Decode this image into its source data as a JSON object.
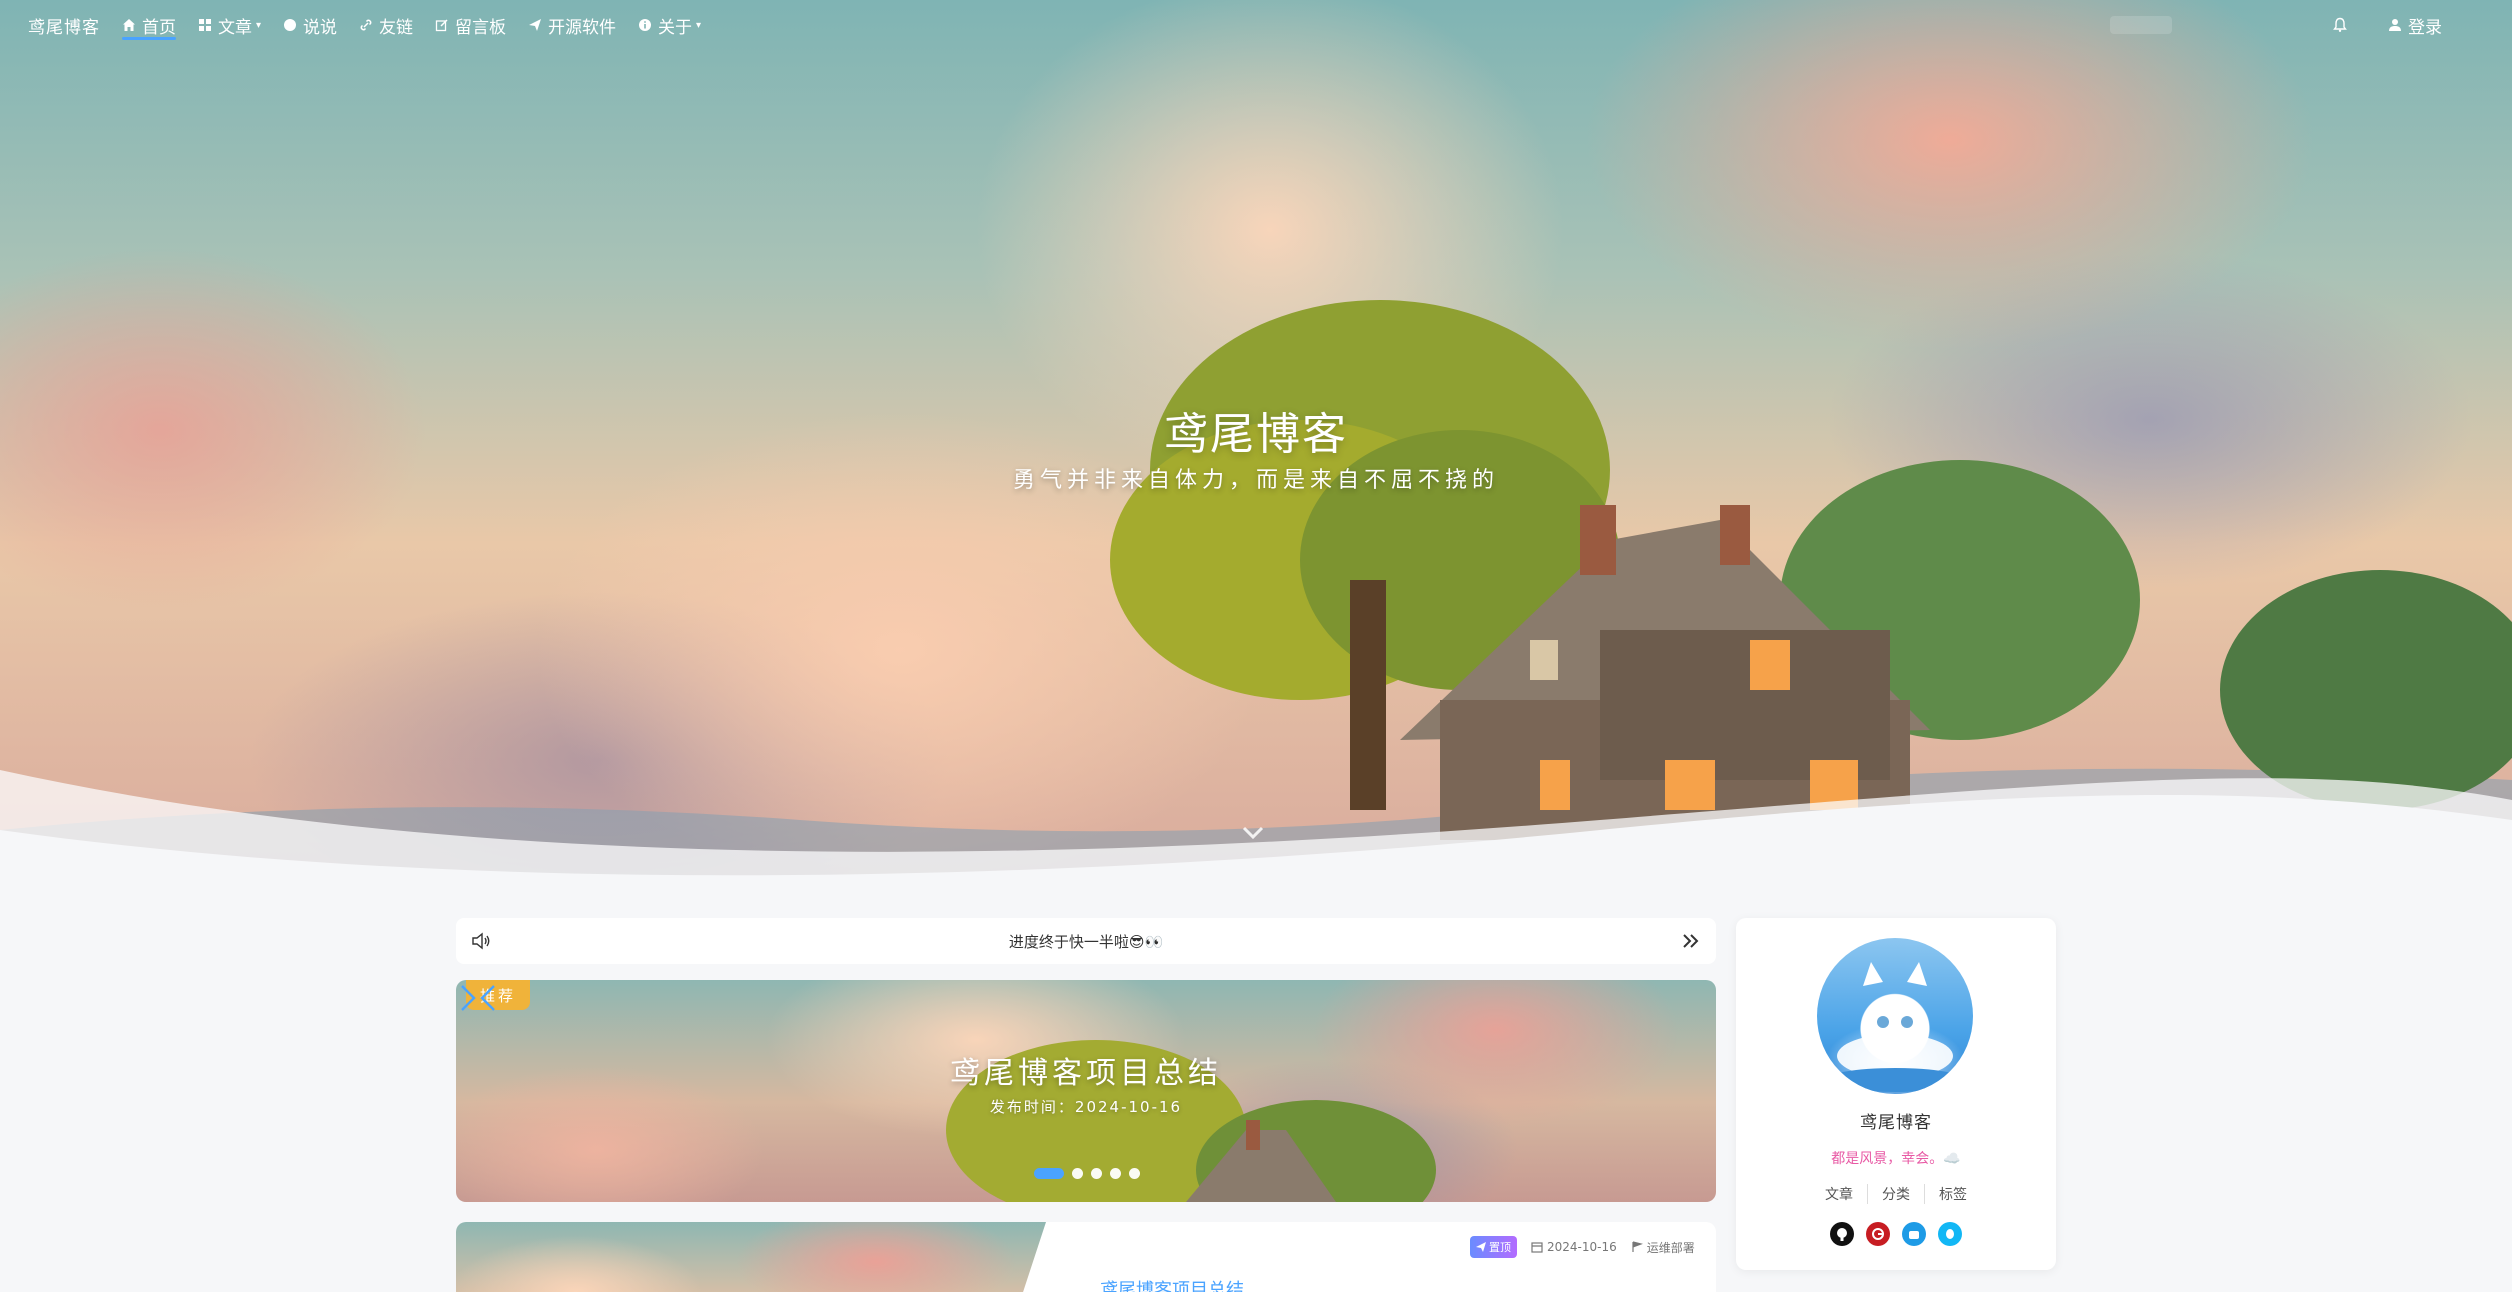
{
  "nav": {
    "brand": "鸢尾博客",
    "items": [
      {
        "label": "首页",
        "icon": "home-icon"
      },
      {
        "label": "文章",
        "icon": "grid-icon"
      },
      {
        "label": "说说",
        "icon": "chat-icon"
      },
      {
        "label": "友链",
        "icon": "link-icon"
      },
      {
        "label": "留言板",
        "icon": "edit-icon"
      },
      {
        "label": "开源软件",
        "icon": "send-icon"
      },
      {
        "label": "关于",
        "icon": "info-icon"
      }
    ],
    "login_label": "登录",
    "accent": "#4aa3ff"
  },
  "hero": {
    "title": "鸢尾博客",
    "subtitle": "勇气并非来自体力，而是来自不屈不挠的"
  },
  "notice": {
    "text": "进度终于快一半啦😎👀"
  },
  "carousel": {
    "badge": "推荐",
    "title": "鸢尾博客项目总结",
    "date": "发布时间：2024-10-16",
    "slide_count": 5,
    "active_slide": 1
  },
  "article": {
    "tag": "置顶",
    "date": "2024-10-16",
    "category": "运维部署",
    "title": "鸢尾博客项目总结"
  },
  "profile": {
    "name": "鸢尾博客",
    "motto": "都是风景，幸会。☁️",
    "links": [
      "文章",
      "分类",
      "标签"
    ],
    "social": [
      {
        "icon": "github-icon",
        "color": "#111111"
      },
      {
        "icon": "gitee-icon",
        "color": "#c71d23"
      },
      {
        "icon": "bilibili-icon",
        "color": "#1e9be6"
      },
      {
        "icon": "qq-icon",
        "color": "#12b7f5"
      }
    ]
  }
}
